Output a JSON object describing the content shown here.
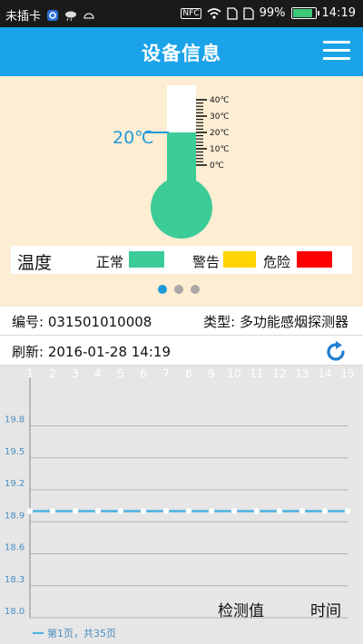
{
  "status_bar": {
    "carrier": "未插卡",
    "battery": "99%",
    "time": "14:19",
    "nfc": "NFC"
  },
  "header": {
    "title": "设备信息"
  },
  "thermometer": {
    "current": "20℃",
    "scale": [
      "40℃",
      "30℃",
      "20℃",
      "10℃",
      "0℃"
    ],
    "fill_fraction": 0.5,
    "legend": {
      "title": "温度",
      "items": [
        {
          "label": "正常",
          "color": "#3ccc98"
        },
        {
          "label": "警告",
          "color": "#ffd400"
        },
        {
          "label": "危险",
          "color": "#ff0000"
        }
      ]
    },
    "mercury_color": "#3ccc98"
  },
  "pager": {
    "count": 3,
    "active": 0
  },
  "device": {
    "id_label": "编号: 031501010008",
    "type_label": "类型: 多功能感烟探测器",
    "refresh_label": "刷新: 2016-01-28 14:19"
  },
  "chart_data": {
    "type": "line",
    "x": [
      1,
      2,
      3,
      4,
      5,
      6,
      7,
      8,
      9,
      10,
      11,
      12,
      13,
      14,
      15
    ],
    "series": [
      {
        "values": [
          19.0,
          19.0,
          19.0,
          19.0,
          19.0,
          19.0,
          19.0,
          19.0,
          19.0,
          19.0,
          19.0,
          19.0,
          19.0,
          19.0,
          19.0
        ]
      }
    ],
    "ylim": [
      18.0,
      20.0
    ],
    "yticks": [
      "19.8",
      "19.5",
      "19.2",
      "18.9",
      "18.6",
      "18.3",
      "18.0"
    ],
    "ylabel": "检测值",
    "xlabel": "时间",
    "grid": true,
    "line_color": "#4ab0e0",
    "footer": "第1页，共35页"
  }
}
